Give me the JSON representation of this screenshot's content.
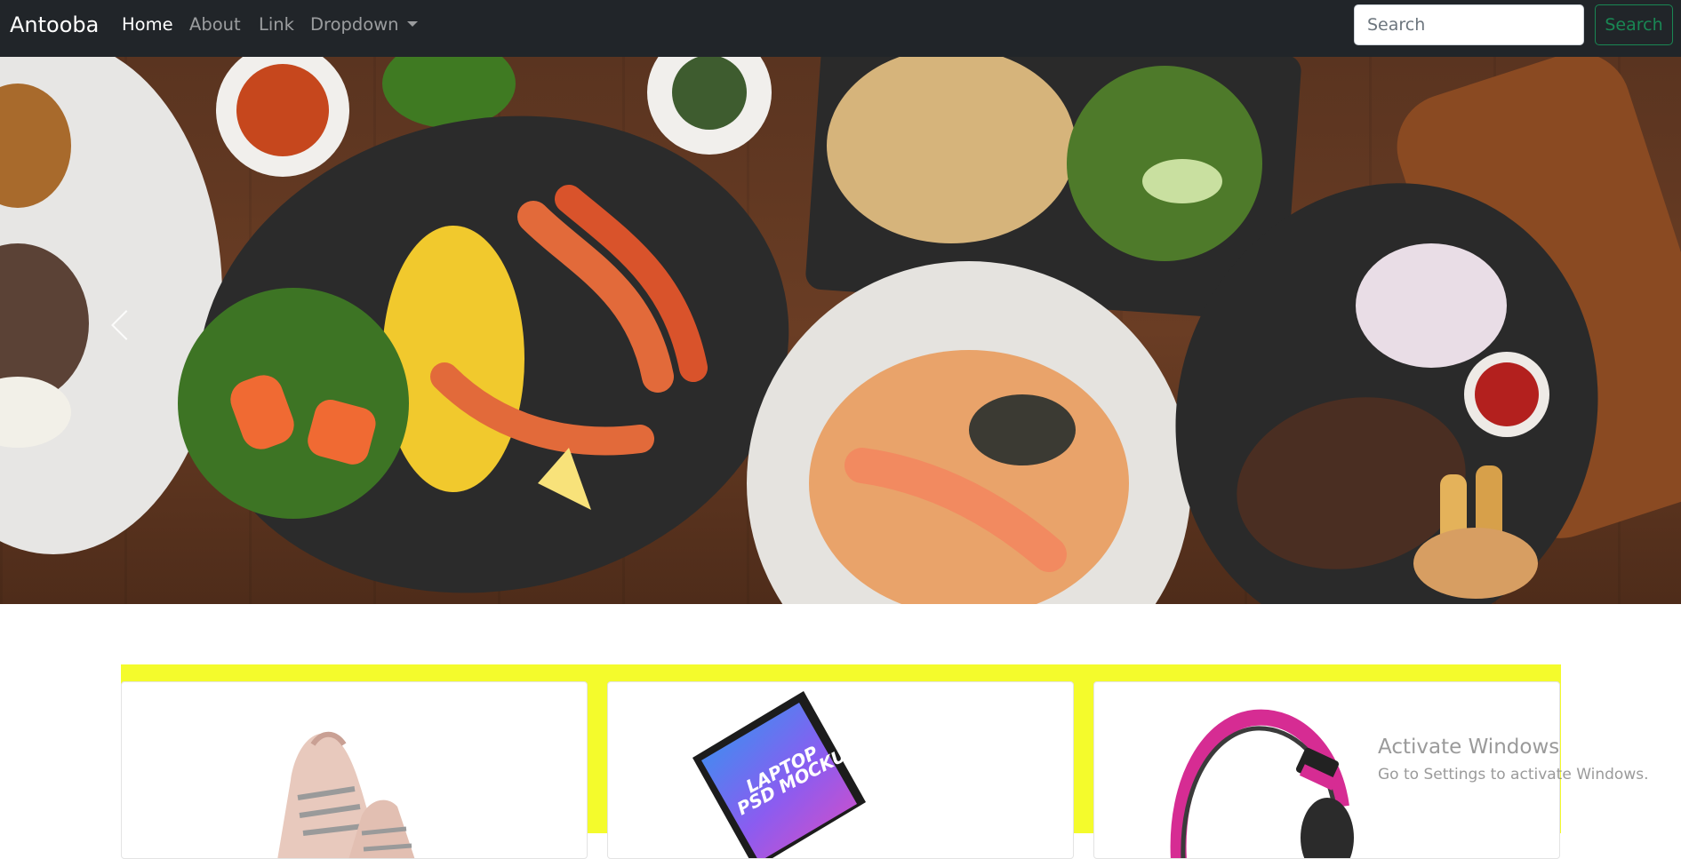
{
  "navbar": {
    "brand": "Antooba",
    "links": [
      {
        "label": "Home",
        "active": true
      },
      {
        "label": "About",
        "active": false
      },
      {
        "label": "Link",
        "active": false
      },
      {
        "label": "Dropdown",
        "active": false
      }
    ],
    "search": {
      "placeholder": "Search",
      "value": ""
    },
    "search_button": "Search"
  },
  "carousel": {
    "prev_icon": "chevron-left-icon",
    "next_icon": "chevron-right-icon"
  },
  "products": [
    {
      "image": "sneakers"
    },
    {
      "image": "laptop",
      "screen_text": [
        "LAPTOP",
        "PSD MOCKUP"
      ]
    },
    {
      "image": "headphones"
    }
  ],
  "watermark": {
    "title": "Activate Windows",
    "subtitle": "Go to Settings to activate Windows."
  },
  "colors": {
    "navbar_bg": "#212529",
    "accent_green": "#198754",
    "product_section_bg": "#f4fb2c"
  }
}
